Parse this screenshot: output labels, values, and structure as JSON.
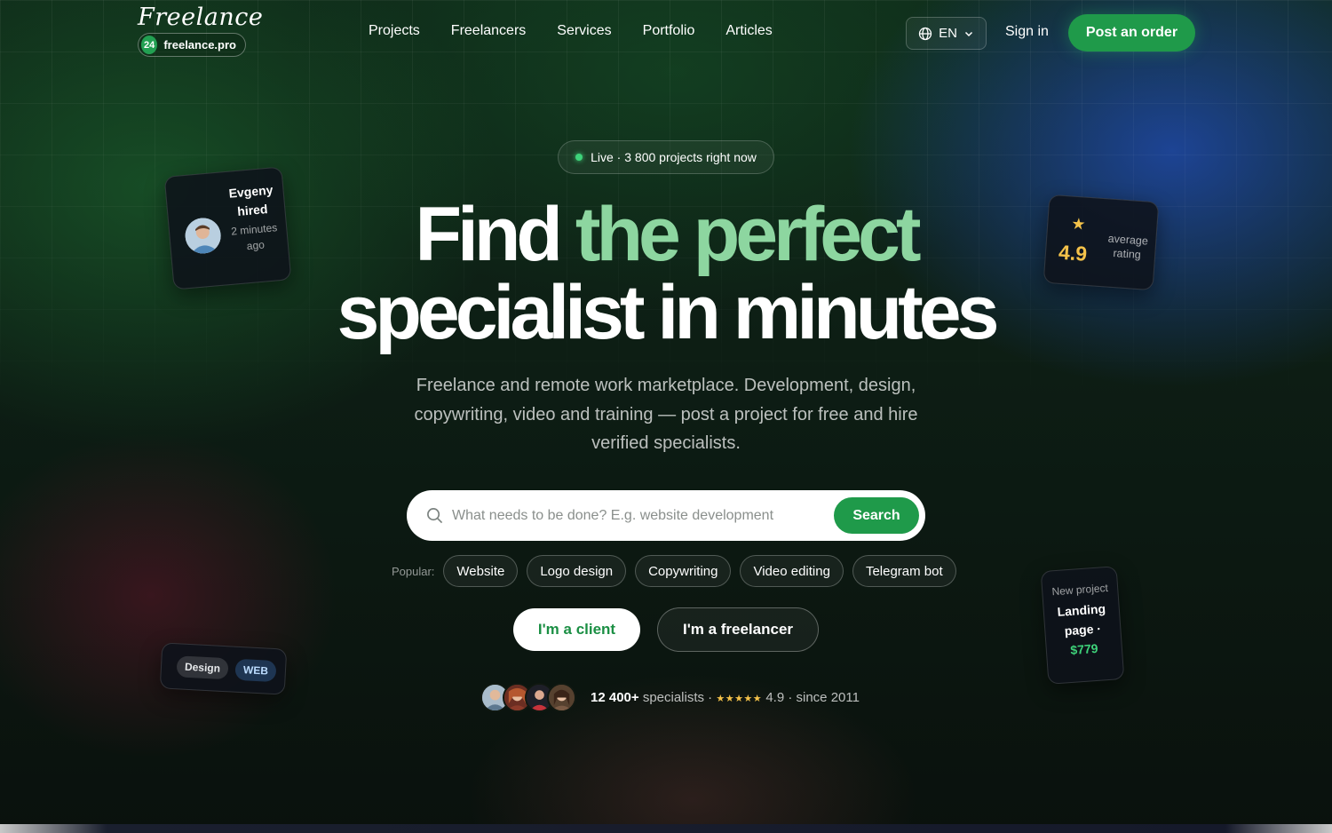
{
  "brand": {
    "script": "Freelance",
    "badge": "24",
    "domain": "freelance.pro"
  },
  "nav": [
    "Projects",
    "Freelancers",
    "Services",
    "Portfolio",
    "Articles"
  ],
  "header": {
    "language": "EN",
    "sign_in": "Sign in",
    "post_order": "Post an order"
  },
  "live": {
    "text": "Live · 3 800 projects right now"
  },
  "hero": {
    "title_part1": "Find",
    "title_accent": "the perfect",
    "title_line2": "specialist in minutes",
    "subtitle": "Freelance and remote work marketplace. Development, design, copywriting, video and training — post a project for free and hire verified specialists."
  },
  "search": {
    "placeholder": "What needs to be done? E.g. website development",
    "button": "Search"
  },
  "popular": {
    "label": "Popular:",
    "chips": [
      "Website",
      "Logo design",
      "Copywriting",
      "Video editing",
      "Telegram bot"
    ]
  },
  "roles": {
    "client": "I'm a client",
    "freelancer": "I'm a freelancer"
  },
  "proof": {
    "count": "12 400+",
    "label": "specialists ·",
    "stars": "★★★★★",
    "rating": "4.9 · since 2011"
  },
  "cards": {
    "hired": {
      "name": "Evgeny hired",
      "time": "2 minutes ago"
    },
    "rating": {
      "value": "4.9",
      "label": "average rating"
    },
    "tags": [
      "Design",
      "WEB"
    ],
    "new_project": {
      "label": "New project",
      "title": "Landing page ·",
      "price": "$779"
    }
  },
  "colors": {
    "accent_green": "#1f9a4a",
    "headline_accent": "#8dd6a0",
    "star": "#f4c24a"
  }
}
